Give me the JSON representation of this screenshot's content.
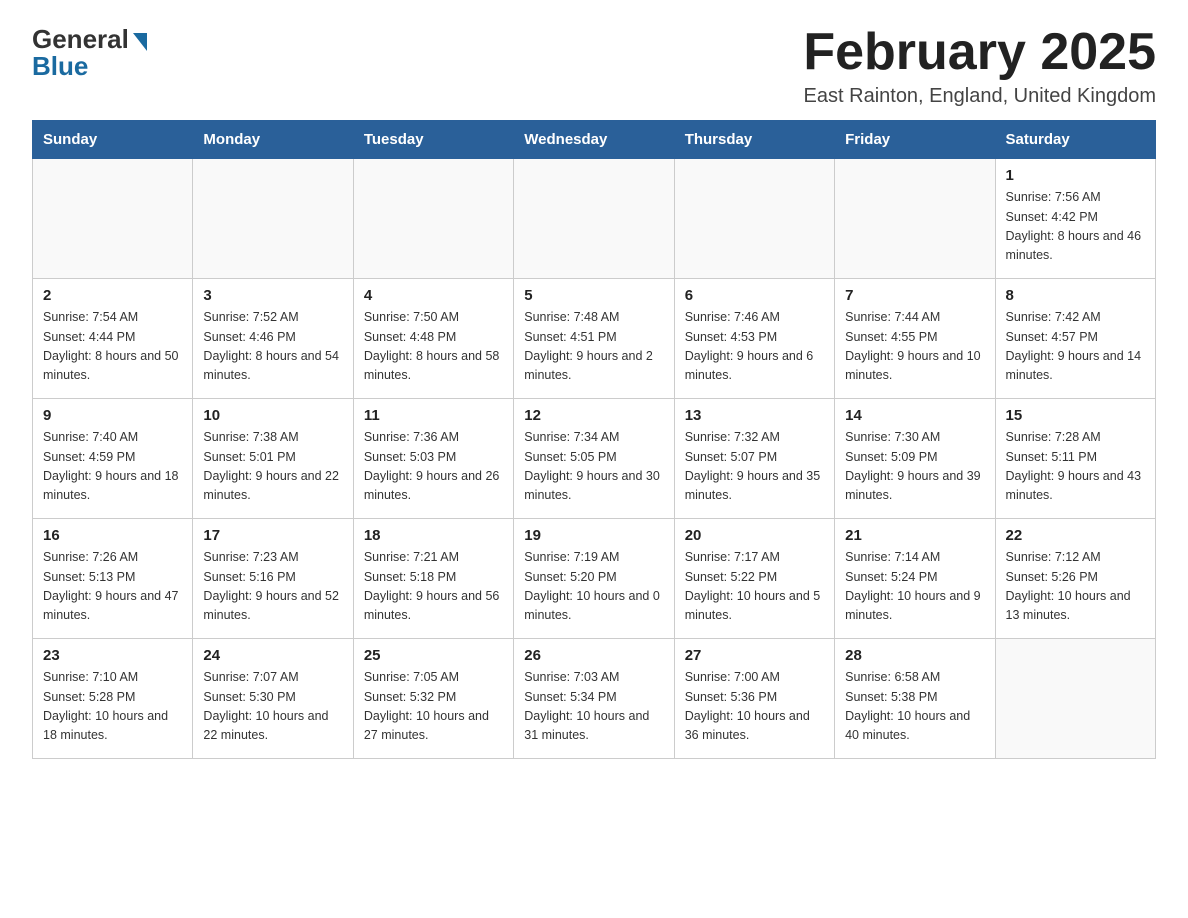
{
  "logo": {
    "general": "General",
    "blue": "Blue"
  },
  "header": {
    "title": "February 2025",
    "location": "East Rainton, England, United Kingdom"
  },
  "weekdays": [
    "Sunday",
    "Monday",
    "Tuesday",
    "Wednesday",
    "Thursday",
    "Friday",
    "Saturday"
  ],
  "weeks": [
    [
      {
        "day": "",
        "info": ""
      },
      {
        "day": "",
        "info": ""
      },
      {
        "day": "",
        "info": ""
      },
      {
        "day": "",
        "info": ""
      },
      {
        "day": "",
        "info": ""
      },
      {
        "day": "",
        "info": ""
      },
      {
        "day": "1",
        "info": "Sunrise: 7:56 AM\nSunset: 4:42 PM\nDaylight: 8 hours and 46 minutes."
      }
    ],
    [
      {
        "day": "2",
        "info": "Sunrise: 7:54 AM\nSunset: 4:44 PM\nDaylight: 8 hours and 50 minutes."
      },
      {
        "day": "3",
        "info": "Sunrise: 7:52 AM\nSunset: 4:46 PM\nDaylight: 8 hours and 54 minutes."
      },
      {
        "day": "4",
        "info": "Sunrise: 7:50 AM\nSunset: 4:48 PM\nDaylight: 8 hours and 58 minutes."
      },
      {
        "day": "5",
        "info": "Sunrise: 7:48 AM\nSunset: 4:51 PM\nDaylight: 9 hours and 2 minutes."
      },
      {
        "day": "6",
        "info": "Sunrise: 7:46 AM\nSunset: 4:53 PM\nDaylight: 9 hours and 6 minutes."
      },
      {
        "day": "7",
        "info": "Sunrise: 7:44 AM\nSunset: 4:55 PM\nDaylight: 9 hours and 10 minutes."
      },
      {
        "day": "8",
        "info": "Sunrise: 7:42 AM\nSunset: 4:57 PM\nDaylight: 9 hours and 14 minutes."
      }
    ],
    [
      {
        "day": "9",
        "info": "Sunrise: 7:40 AM\nSunset: 4:59 PM\nDaylight: 9 hours and 18 minutes."
      },
      {
        "day": "10",
        "info": "Sunrise: 7:38 AM\nSunset: 5:01 PM\nDaylight: 9 hours and 22 minutes."
      },
      {
        "day": "11",
        "info": "Sunrise: 7:36 AM\nSunset: 5:03 PM\nDaylight: 9 hours and 26 minutes."
      },
      {
        "day": "12",
        "info": "Sunrise: 7:34 AM\nSunset: 5:05 PM\nDaylight: 9 hours and 30 minutes."
      },
      {
        "day": "13",
        "info": "Sunrise: 7:32 AM\nSunset: 5:07 PM\nDaylight: 9 hours and 35 minutes."
      },
      {
        "day": "14",
        "info": "Sunrise: 7:30 AM\nSunset: 5:09 PM\nDaylight: 9 hours and 39 minutes."
      },
      {
        "day": "15",
        "info": "Sunrise: 7:28 AM\nSunset: 5:11 PM\nDaylight: 9 hours and 43 minutes."
      }
    ],
    [
      {
        "day": "16",
        "info": "Sunrise: 7:26 AM\nSunset: 5:13 PM\nDaylight: 9 hours and 47 minutes."
      },
      {
        "day": "17",
        "info": "Sunrise: 7:23 AM\nSunset: 5:16 PM\nDaylight: 9 hours and 52 minutes."
      },
      {
        "day": "18",
        "info": "Sunrise: 7:21 AM\nSunset: 5:18 PM\nDaylight: 9 hours and 56 minutes."
      },
      {
        "day": "19",
        "info": "Sunrise: 7:19 AM\nSunset: 5:20 PM\nDaylight: 10 hours and 0 minutes."
      },
      {
        "day": "20",
        "info": "Sunrise: 7:17 AM\nSunset: 5:22 PM\nDaylight: 10 hours and 5 minutes."
      },
      {
        "day": "21",
        "info": "Sunrise: 7:14 AM\nSunset: 5:24 PM\nDaylight: 10 hours and 9 minutes."
      },
      {
        "day": "22",
        "info": "Sunrise: 7:12 AM\nSunset: 5:26 PM\nDaylight: 10 hours and 13 minutes."
      }
    ],
    [
      {
        "day": "23",
        "info": "Sunrise: 7:10 AM\nSunset: 5:28 PM\nDaylight: 10 hours and 18 minutes."
      },
      {
        "day": "24",
        "info": "Sunrise: 7:07 AM\nSunset: 5:30 PM\nDaylight: 10 hours and 22 minutes."
      },
      {
        "day": "25",
        "info": "Sunrise: 7:05 AM\nSunset: 5:32 PM\nDaylight: 10 hours and 27 minutes."
      },
      {
        "day": "26",
        "info": "Sunrise: 7:03 AM\nSunset: 5:34 PM\nDaylight: 10 hours and 31 minutes."
      },
      {
        "day": "27",
        "info": "Sunrise: 7:00 AM\nSunset: 5:36 PM\nDaylight: 10 hours and 36 minutes."
      },
      {
        "day": "28",
        "info": "Sunrise: 6:58 AM\nSunset: 5:38 PM\nDaylight: 10 hours and 40 minutes."
      },
      {
        "day": "",
        "info": ""
      }
    ]
  ]
}
